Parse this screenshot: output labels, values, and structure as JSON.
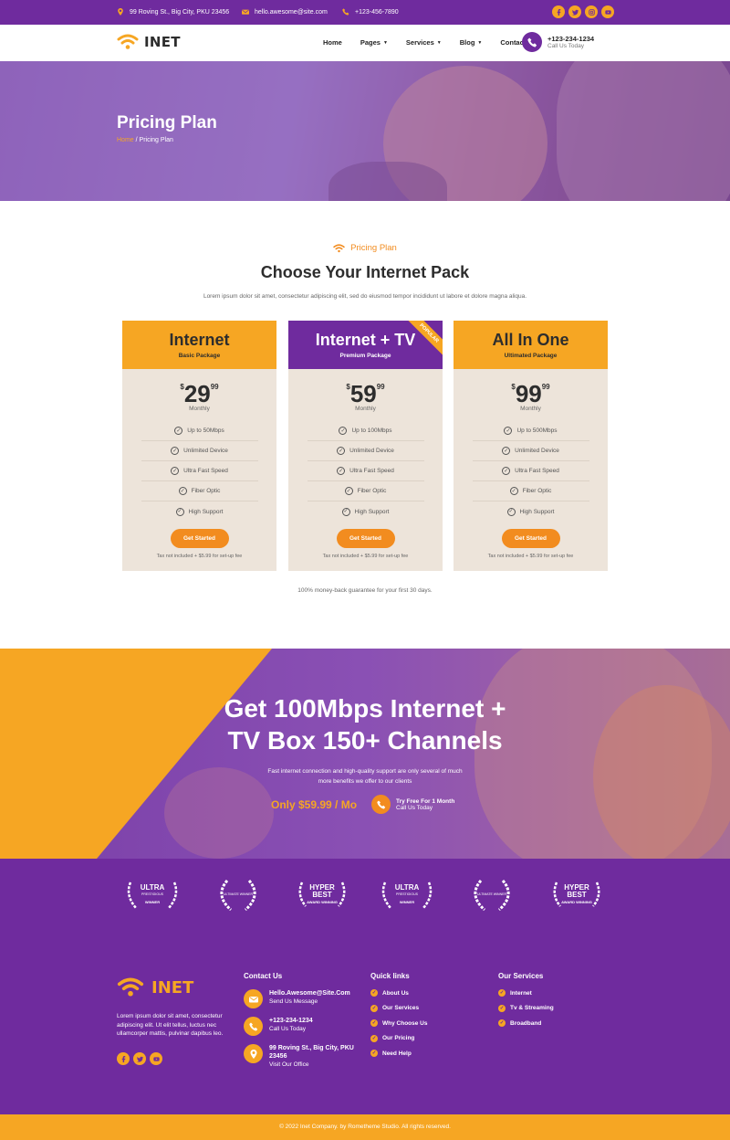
{
  "topbar": {
    "address": "99 Roving St., Big City, PKU 23456",
    "email": "hello.awesome@site.com",
    "phone": "+123-456-7890",
    "social_icons": [
      "facebook-icon",
      "twitter-icon",
      "instagram-icon",
      "youtube-icon"
    ]
  },
  "nav": {
    "logo_text": "INET",
    "menu": [
      {
        "label": "Home",
        "has_caret": false
      },
      {
        "label": "Pages",
        "has_caret": true
      },
      {
        "label": "Services",
        "has_caret": true
      },
      {
        "label": "Blog",
        "has_caret": true
      },
      {
        "label": "Contact",
        "has_caret": false
      }
    ],
    "call_number": "+123-234-1234",
    "call_label": "Call Us Today"
  },
  "hero": {
    "title": "Pricing Plan",
    "crumb_home": "Home",
    "crumb_sep": " / ",
    "crumb_current": "Pricing Plan"
  },
  "pricing": {
    "eyebrow": "Pricing Plan",
    "title": "Choose Your Internet Pack",
    "description": "Lorem ipsum dolor sit amet, consectetur adipiscing elit, sed do eiusmod tempor incididunt ut labore et dolore magna aliqua.",
    "plans": [
      {
        "name": "Internet",
        "subtitle": "Basic Package",
        "currency": "$",
        "amount": "29",
        "cents": "99",
        "period": "Monthly",
        "features": [
          "Up to 50Mbps",
          "Unlimited Device",
          "Ultra Fast Speed",
          "Fiber Optic",
          "High Support"
        ],
        "button": "Get Started",
        "note": "Tax not included + $5.99 for set-up fee",
        "header_color": "#f6a623"
      },
      {
        "name": "Internet + TV",
        "subtitle": "Premium Package",
        "currency": "$",
        "amount": "59",
        "cents": "99",
        "period": "Monthly",
        "features": [
          "Up to 100Mbps",
          "Unlimited Device",
          "Ultra Fast Speed",
          "Fiber Optic",
          "High Support"
        ],
        "button": "Get Started",
        "note": "Tax not included + $5.99 for set-up fee",
        "header_color": "#6f2b9e",
        "ribbon": "POPULAR"
      },
      {
        "name": "All In One",
        "subtitle": "Ultimated Package",
        "currency": "$",
        "amount": "99",
        "cents": "99",
        "period": "Monthly",
        "features": [
          "Up to 500Mbps",
          "Unlimited Device",
          "Ultra Fast Speed",
          "Fiber Optic",
          "High Support"
        ],
        "button": "Get Started",
        "note": "Tax not included + $5.99 for set-up fee",
        "header_color": "#f6a623"
      }
    ],
    "guarantee": "100% money-back guarantee for your first 30 days."
  },
  "promo": {
    "title_line1": "Get 100Mbps Internet +",
    "title_line2": "TV Box 150+ Channels",
    "desc_line1": "Fast internet connection and high-quality support are only several of much",
    "desc_line2": "more benefits we offer to our clients",
    "price": "Only $59.99 / Mo",
    "cta_title": "Try Free For 1 Month",
    "cta_sub": "Call Us Today"
  },
  "awards": [
    {
      "l1": "ULTRA",
      "l2": "PRESTIGIOUS",
      "l3": "WINNER"
    },
    {
      "l1": "",
      "l2": "ULTIMATE WINNER",
      "l3": ""
    },
    {
      "l1": "HYPER",
      "l2": "BEST",
      "l3": "AWARD WINNING"
    },
    {
      "l1": "ULTRA",
      "l2": "PRESTIGIOUS",
      "l3": "WINNER"
    },
    {
      "l1": "",
      "l2": "ULTIMATE WINNER",
      "l3": ""
    },
    {
      "l1": "HYPER",
      "l2": "BEST",
      "l3": "AWARD WINNING"
    }
  ],
  "footer": {
    "logo_text": "INET",
    "description": "Lorem ipsum dolor sit amet, consectetur adipiscing elit. Ut elit tellus, luctus nec ullamcorper mattis, pulvinar dapibus leo.",
    "contact_title": "Contact Us",
    "contacts": [
      {
        "icon": "mail-icon",
        "main": "Hello.Awesome@Site.Com",
        "sub": "Send Us Message"
      },
      {
        "icon": "phone-icon",
        "main": "+123-234-1234",
        "sub": "Call Us Today"
      },
      {
        "icon": "location-icon",
        "main": "99 Roving St., Big City, PKU 23456",
        "sub": "Visit Our Office"
      }
    ],
    "quick_title": "Quick links",
    "quick_links": [
      "About Us",
      "Our Services",
      "Why Choose Us",
      "Our Pricing",
      "Need Help"
    ],
    "services_title": "Our Services",
    "services": [
      "Internet",
      "Tv & Streaming",
      "Broadband"
    ],
    "copyright": "© 2022 Inet Company. by Rometheme Studio. All rights reserved."
  },
  "colors": {
    "purple": "#6f2b9e",
    "orange": "#f28c1f",
    "yellow": "#f6a623",
    "card_bg": "#ede4da"
  }
}
